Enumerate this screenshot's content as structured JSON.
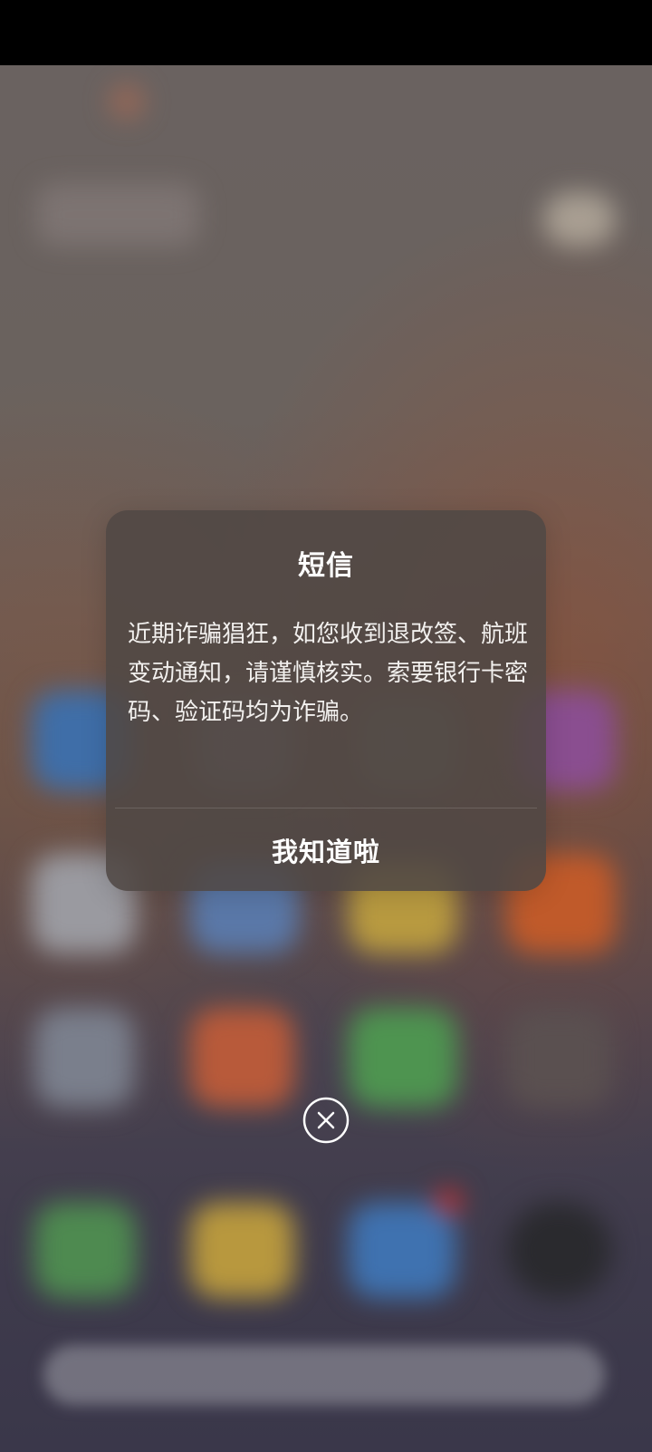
{
  "dialog": {
    "title": "短信",
    "message": "近期诈骗猖狂，如您收到退改签、航班变动通知，请谨慎核实。索要银行卡密码、验证码均为诈骗。",
    "confirm_label": "我知道啦"
  },
  "close_button": {
    "icon": "close-circle-icon"
  },
  "colors": {
    "dialog_background": "#504844",
    "text": "#ffffff"
  }
}
